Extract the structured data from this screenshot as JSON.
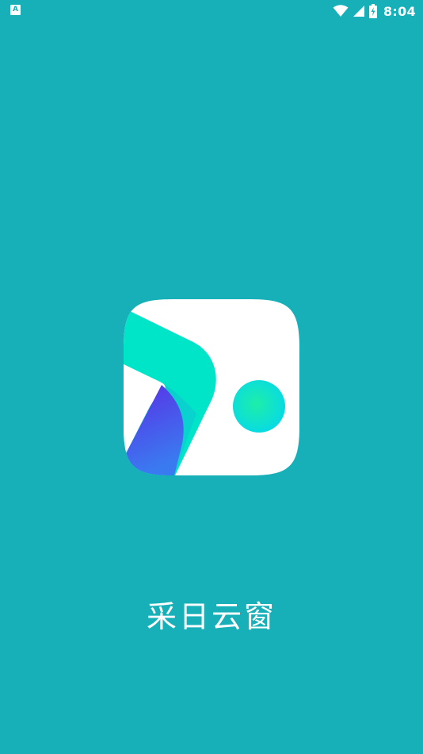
{
  "status_bar": {
    "notification_icon_letter": "A",
    "time": "8:04",
    "icons": [
      "wifi-icon",
      "cellular-signal-icon",
      "battery-charging-icon"
    ]
  },
  "splash": {
    "app_name": "采日云窗"
  },
  "colors": {
    "background": "#17b0b9",
    "logo_tile": "#ffffff",
    "logo_green": "#00e5c8",
    "logo_blue": "#4a3ee8",
    "logo_dot": "#12e4d0",
    "text": "#ffffff"
  }
}
